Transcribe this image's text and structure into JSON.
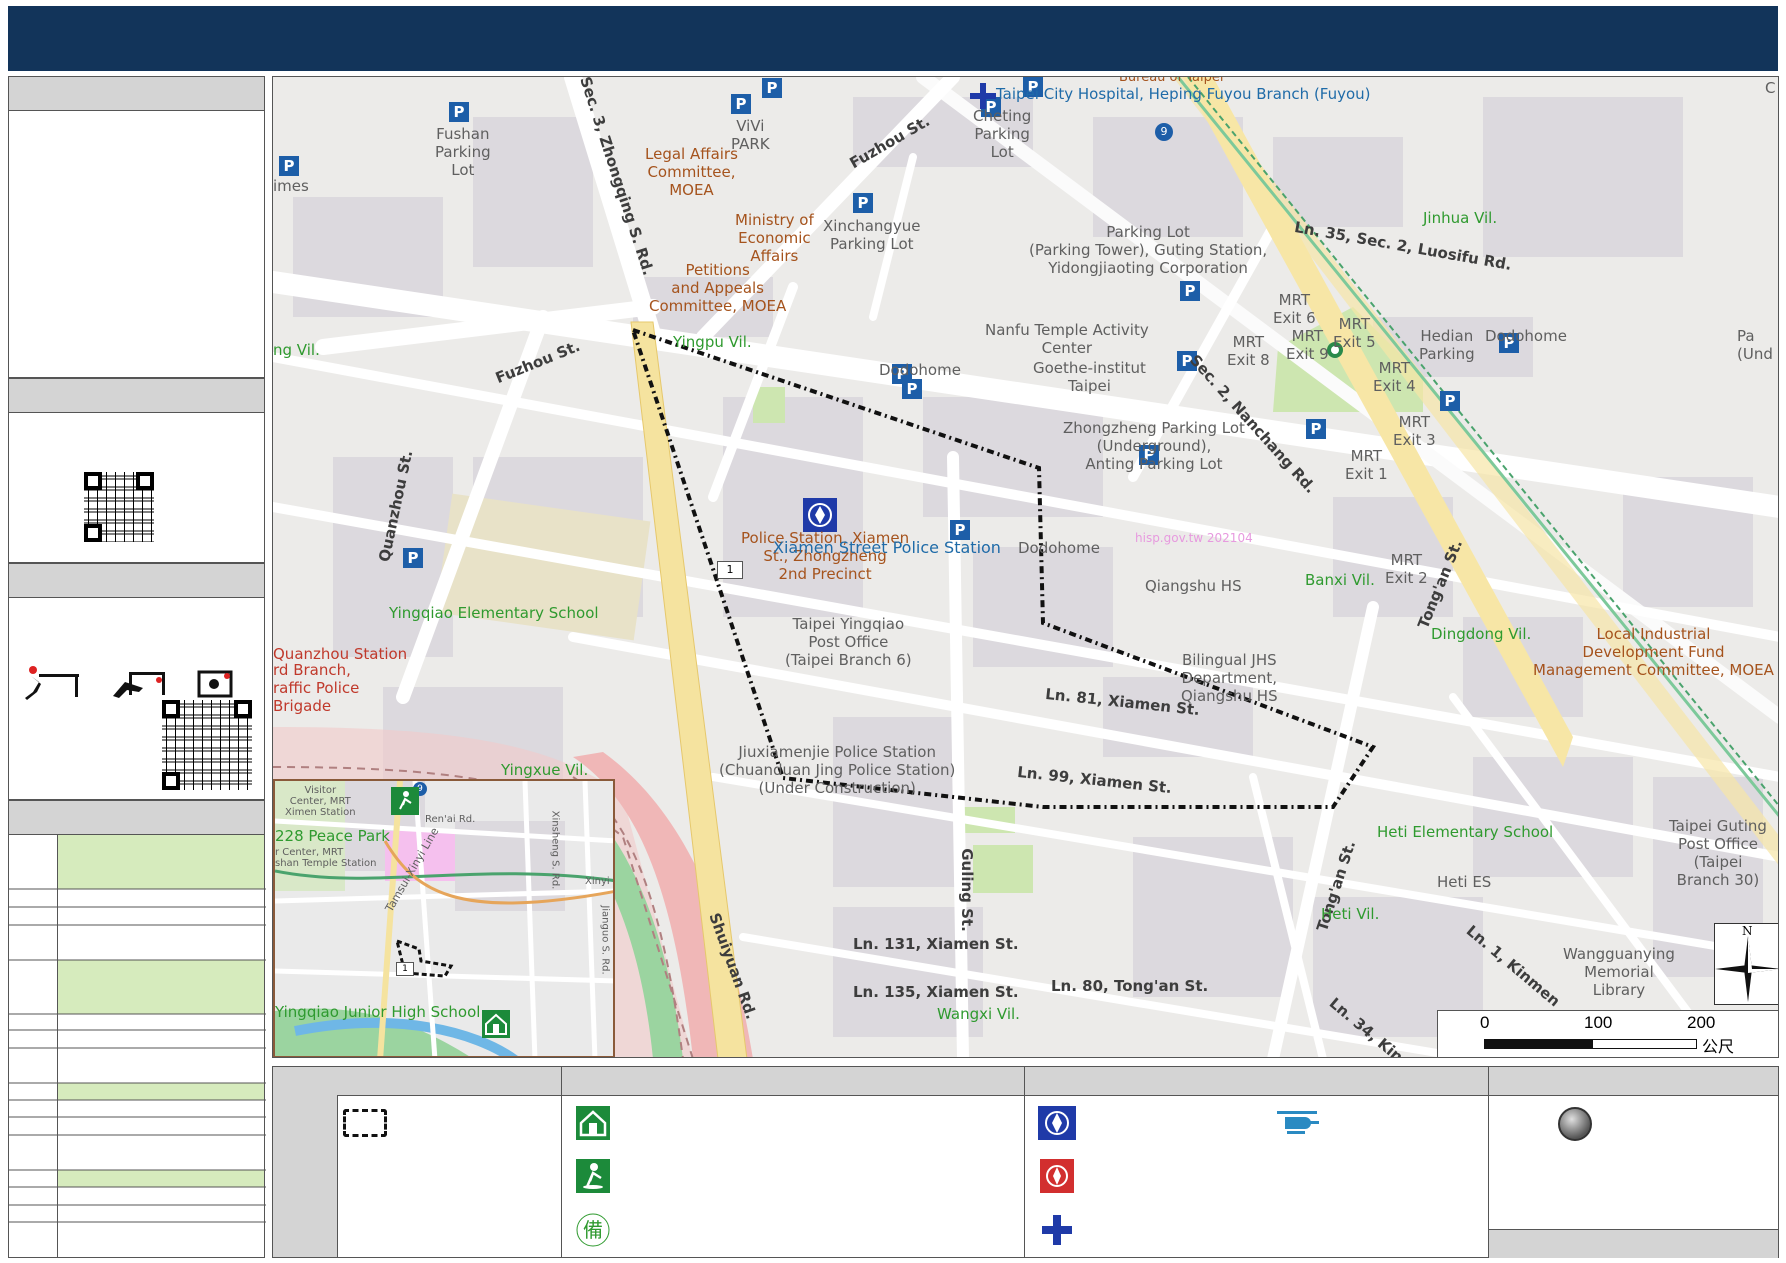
{
  "map": {
    "labels": {
      "fushan_parking": "Fushan\nParking\nLot",
      "vivi_park": "ViVi\nPARK",
      "legal_affairs": "Legal Affairs\nCommittee,\nMOEA",
      "ministry": "Ministry of\nEconomic\nAffairs",
      "petitions": "Petitions\nand Appeals\nCommittee, MOEA",
      "xinchangyue": "Xinchangyue\nParking Lot",
      "cheting": "Cheting\nParking\nLot",
      "hospital": "Taipei City Hospital, Heping Fuyou Branch (Fuyou)",
      "bureau": "Bureau of Taipei",
      "imes": "imes",
      "jinhua": "Jinhua Vil.",
      "parking_tower": "Parking Lot\n(Parking Tower), Guting Station,\nYidongjiaoting Corporation",
      "luosifu": "Ln. 35, Sec. 2, Luosifu Rd.",
      "nanfu": "Nanfu Temple Activity\nCenter",
      "mrt6": "MRT\nExit 6",
      "mrt8": "MRT\nExit 8",
      "mrt9": "MRT\nExit 9",
      "mrt5": "MRT\nExit 5",
      "hedian": "Hedian\nParking",
      "dodohome_r": "Dodohome",
      "pa_und": "Pa\n(Und",
      "ng_vil": "ng Vil.",
      "yingpu": "Yingpu Vil.",
      "fuzhou_w": "Fuzhou St.",
      "fuzhou_n": "Fuzhou St.",
      "zhongqing": "Sec. 3, Zhongqing S. Rd.",
      "dodohome_c": "Dodohome",
      "goethe": "Goethe-institut\nTaipei",
      "mrt4": "MRT\nExit 4",
      "nanchang": "Sec. 2, Nanchang Rd.",
      "zz_parking": "Zhongzheng Parking Lot\n(Underground),\nAnting Parking Lot",
      "mrt3": "MRT\nExit 3",
      "mrt1": "MRT\nExit 1",
      "quanzhou_st": "Quanzhou St.",
      "police_sub": "Police Station, Xiamen\nSt., Zhongzheng\n2nd Precinct",
      "xiamen_police": "Xiamen Street Police Station",
      "dodohome_s": "Dodohome",
      "watermark": "hisp.gov.tw 202104",
      "qiangshu": "Qiangshu HS",
      "banxi": "Banxi Vil.",
      "mrt2": "MRT\nExit 2",
      "tongan_ne": "Tong'an St.",
      "yingqiao_es": "Yingqiao Elementary School",
      "post_office": "Taipei Yingqiao\nPost Office\n(Taipei Branch 6)",
      "bilingual": "Bilingual JHS\nDepartment,\nQiangshu HS",
      "dingdong": "Dingdong Vil.",
      "local_ind": "Local Industrial\nDevelopment Fund\nManagement Committee, MOEA",
      "quanzhou_station": "Quanzhou Station",
      "traffic": "rd Branch,\nraffic Police\nBrigade",
      "ln81": "Ln. 81, Xiamen St.",
      "jiuxiamen": "Jiuxiamenjie Police Station\n(Chuanduan Jing Police Station)\n(Under Construction)",
      "ln99": "Ln. 99, Xiamen St.",
      "yingxue": "Yingxue Vil.",
      "heti_es": "Heti Elementary School",
      "heti_es2": "Heti ES",
      "guting_post": "Taipei Guting\nPost Office\n(Taipei\nBranch 30)",
      "guling": "Guling St.",
      "tongan_s": "Tong'an St.",
      "heti_vil": "Heti Vil.",
      "shuiyuan": "Shuiyuan Rd.",
      "ln131": "Ln. 131, Xiamen St.",
      "ln135": "Ln. 135, Xiamen St.",
      "ln80": "Ln. 80, Tong'an St.",
      "wangxi": "Wangxi Vil.",
      "wangguanying": "Wangguanying\nMemorial\nLibrary",
      "kinmen": "Ln. 1, Kinmen",
      "ln34": "Ln. 34, Kin"
    },
    "scale": {
      "v0": "0",
      "v100": "100",
      "v200": "200",
      "unit": "公尺"
    },
    "north": "N",
    "corner_c": "C"
  },
  "inset": {
    "peace_park": "228 Peace Park",
    "yingqiao_jhs": "Yingqiao Junior High School",
    "visitor": "Visitor\nCenter, MRT\nXimen Station",
    "visitor2": "r Center, MRT\nshan Temple Station",
    "xinyi_line": "Tamsui-Xinyi Line",
    "renai": "Ren'ai Rd.",
    "xinyi": "Xinyi",
    "xinsheng": "Xinsheng S. Rd.",
    "jianguo": "Jianguo S. Rd.",
    "route1": "1",
    "route9": "9"
  },
  "route_shield": "1",
  "route_shield_inset": "1"
}
